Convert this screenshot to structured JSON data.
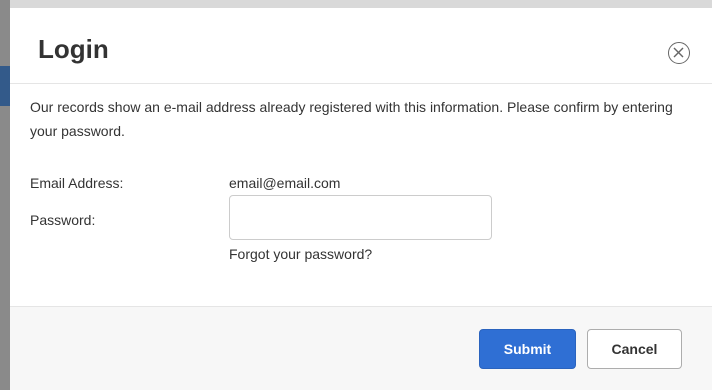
{
  "modal": {
    "title": "Login",
    "intro_text": "Our records show an e-mail address already registered with this information. Please confirm by entering your password.",
    "fields": {
      "email_label": "Email Address:",
      "email_value": "email@email.com",
      "password_label": "Password:",
      "password_value": "",
      "password_placeholder": ""
    },
    "forgot_link": "Forgot your password?",
    "buttons": {
      "submit_label": "Submit",
      "cancel_label": "Cancel"
    },
    "icons": {
      "close": "close-circle-icon"
    },
    "colors": {
      "primary": "#2f6fd4",
      "footer_bg": "#f7f7f7",
      "text": "#333333"
    }
  }
}
